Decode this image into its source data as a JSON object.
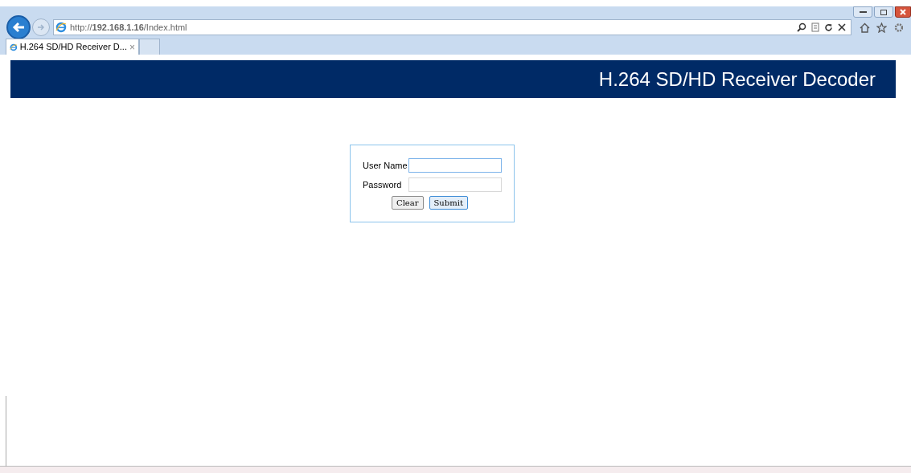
{
  "browser": {
    "address": "http://**192.168.1.16**/Index.html",
    "tabs": [
      {
        "label": "H.264 SD/HD Receiver D...",
        "selected": true,
        "close": "×"
      }
    ]
  },
  "banner": {
    "title": "H.264 SD/HD Receiver Decoder"
  },
  "login": {
    "fields": [
      {
        "label": "User Name",
        "focused": true
      },
      {
        "label": "Password",
        "focused": false
      }
    ],
    "buttons": [
      {
        "label": "Clear",
        "focused": false
      },
      {
        "label": "Submit",
        "focused": true
      }
    ]
  }
}
